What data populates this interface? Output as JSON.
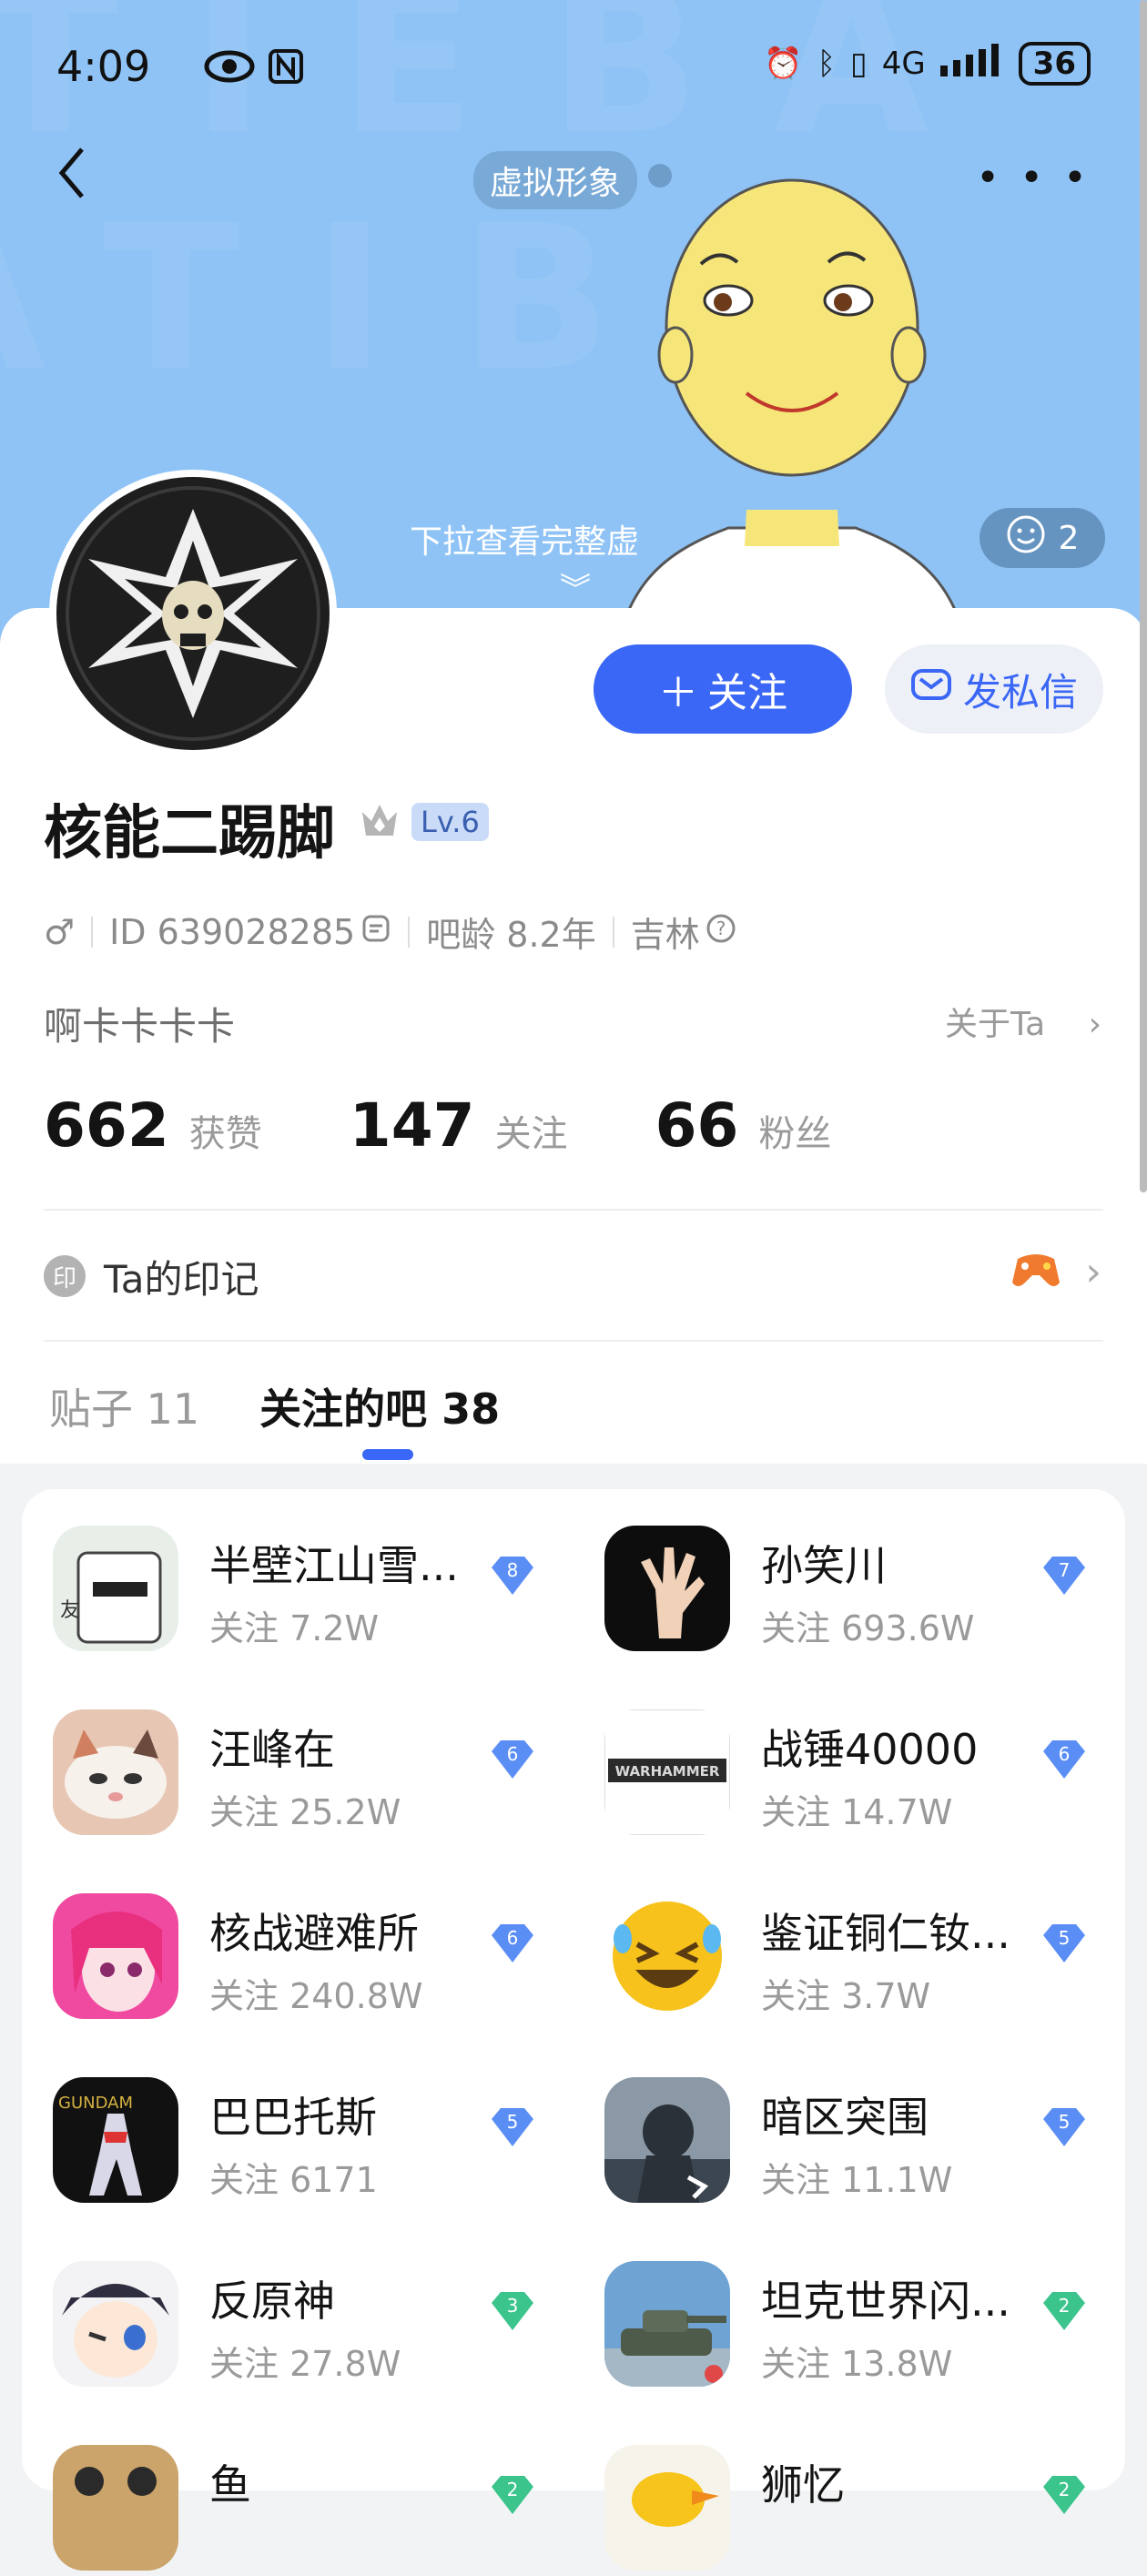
{
  "status_bar": {
    "time": "4:09",
    "battery": "36",
    "network": "4G"
  },
  "header": {
    "avatar_tag": "虚拟形象",
    "pull_hint": "下拉查看完整虚",
    "emoji_count": "2",
    "background_color": "#8fc3f5"
  },
  "actions": {
    "follow_label": "关注",
    "message_label": "发私信",
    "accent": "#3a67f5"
  },
  "profile": {
    "name": "核能二踢脚",
    "level": "Lv.6",
    "gender": "♂",
    "id": "ID 639028285",
    "age": "吧龄 8.2年",
    "location": "吉林",
    "bio": "啊卡卡卡卡",
    "about": "关于Ta"
  },
  "stats": [
    {
      "value": "662",
      "label": "获赞"
    },
    {
      "value": "147",
      "label": "关注"
    },
    {
      "value": "66",
      "label": "粉丝"
    }
  ],
  "marks": {
    "icon_text": "印",
    "label": "Ta的印记"
  },
  "tabs": [
    {
      "label": "贴子 11"
    },
    {
      "label": "关注的吧 38"
    }
  ],
  "bars": [
    {
      "name": "半壁江山雪...",
      "followers": "关注 7.2W",
      "level": "8",
      "badge_color": "#5b8ef5",
      "icon": "manga-icon"
    },
    {
      "name": "孙笑川",
      "followers": "关注 693.6W",
      "level": "7",
      "badge_color": "#5b8ef5",
      "icon": "hand-icon"
    },
    {
      "name": "汪峰在",
      "followers": "关注 25.2W",
      "level": "6",
      "badge_color": "#5b8ef5",
      "icon": "cat-icon"
    },
    {
      "name": "战锤40000",
      "followers": "关注 14.7W",
      "level": "6",
      "badge_color": "#5b8ef5",
      "icon": "warhammer-icon"
    },
    {
      "name": "核战避难所",
      "followers": "关注 240.8W",
      "level": "6",
      "badge_color": "#5b8ef5",
      "icon": "anime-girl-icon"
    },
    {
      "name": "鉴证铜仁钕...",
      "followers": "关注 3.7W",
      "level": "5",
      "badge_color": "#5b8ef5",
      "icon": "laughing-emoji-icon"
    },
    {
      "name": "巴巴托斯",
      "followers": "关注 6171",
      "level": "5",
      "badge_color": "#5b8ef5",
      "icon": "gundam-icon"
    },
    {
      "name": "暗区突围",
      "followers": "关注 11.1W",
      "level": "5",
      "badge_color": "#5b8ef5",
      "icon": "soldier-icon"
    },
    {
      "name": "反原神",
      "followers": "关注 27.8W",
      "level": "3",
      "badge_color": "#3cc48d",
      "icon": "anime-face-icon"
    },
    {
      "name": "坦克世界闪...",
      "followers": "关注 13.8W",
      "level": "2",
      "badge_color": "#3cc48d",
      "icon": "tank-icon"
    },
    {
      "name": "鱼",
      "followers": "",
      "level": "2",
      "badge_color": "#3cc48d",
      "icon": "fish-icon"
    },
    {
      "name": "狮忆",
      "followers": "",
      "level": "2",
      "badge_color": "#3cc48d",
      "icon": "duck-icon"
    }
  ]
}
